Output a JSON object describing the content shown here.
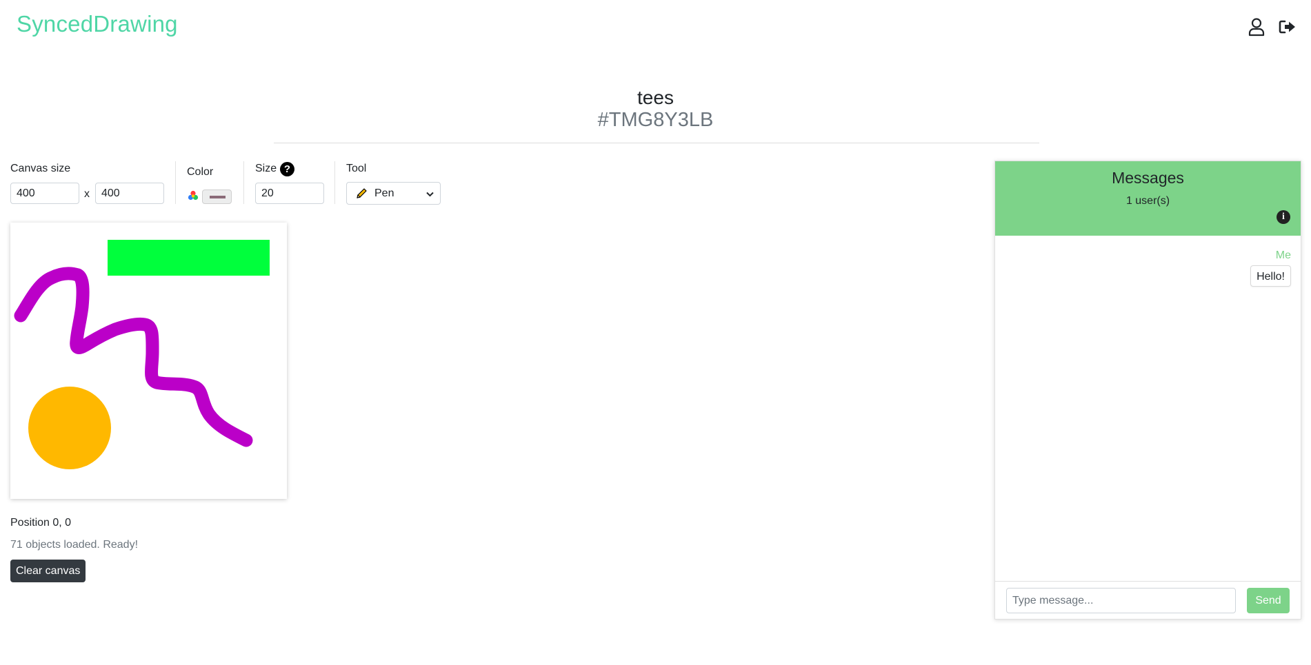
{
  "app": {
    "brand": "SyncedDrawing"
  },
  "nav": {
    "profile_icon": "user-icon",
    "logout_icon": "sign-out-icon"
  },
  "room": {
    "name": "tees",
    "code": "#TMG8Y3LB"
  },
  "controls": {
    "canvas_size_label": "Canvas size",
    "width_value": "400",
    "height_value": "400",
    "times": "x",
    "color_label": "Color",
    "stroke_color": "#8a6b78",
    "size_label": "Size",
    "size_help": "?",
    "size_value": "20",
    "tool_label": "Tool",
    "tool_value": "Pen",
    "tool_icon": "pencil-icon"
  },
  "canvas": {
    "rect_color": "#00ff3c",
    "stroke_color": "#bb00c8",
    "circle_color": "#ffb800"
  },
  "status": {
    "position": "Position 0, 0",
    "loaded": "71 objects loaded. Ready!",
    "clear_label": "Clear canvas"
  },
  "chat": {
    "title": "Messages",
    "users": "1 user(s)",
    "info_icon": "info-icon",
    "messages": [
      {
        "sender": "Me",
        "text": "Hello!"
      }
    ],
    "input_placeholder": "Type message...",
    "send_label": "Send",
    "accent": "#7dd389"
  }
}
